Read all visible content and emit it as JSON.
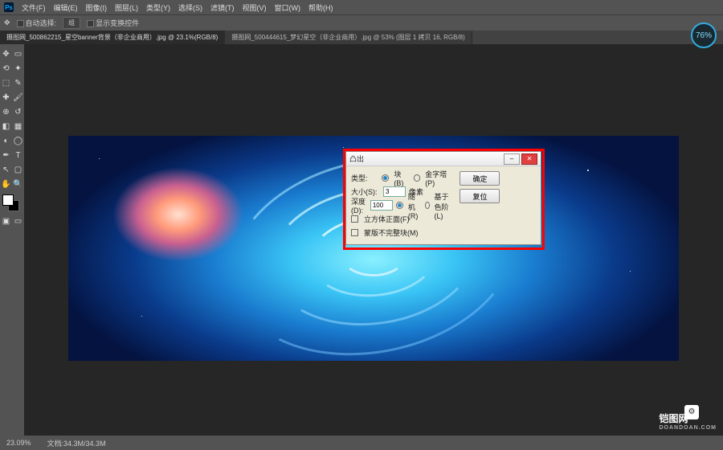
{
  "menubar": [
    "文件(F)",
    "编辑(E)",
    "图像(I)",
    "图层(L)",
    "类型(Y)",
    "选择(S)",
    "滤镜(T)",
    "视图(V)",
    "窗口(W)",
    "帮助(H)"
  ],
  "optbar": {
    "auto": "自动选择:",
    "sel": "组",
    "trans": "显示变换控件"
  },
  "tabs": [
    "摄图网_500862215_星空banner背景（非企业商用）.jpg @ 23.1%(RGB/8)",
    "摄图网_500444615_梦幻星空（非企业商用）.jpg @ 53% (图层 1 拷贝 16, RGB/8)"
  ],
  "pct_badge": "76%",
  "dialog": {
    "title": "凸出",
    "type_lbl": "类型:",
    "type_block": "块(B)",
    "type_pyramid": "金字塔(P)",
    "size_lbl": "大小(S):",
    "size_val": "3",
    "size_unit": "像素",
    "depth_lbl": "深度(D):",
    "depth_val": "100",
    "depth_rand": "随机(R)",
    "depth_level": "基于色阶(L)",
    "chk1": "立方体正面(F)",
    "chk2": "蒙版不完整块(M)",
    "ok": "确定",
    "cancel": "复位"
  },
  "status": {
    "zoom": "23.09%",
    "doc": "文档:34.3M/34.3M"
  },
  "brand": {
    "name": "铠图网",
    "url": "DOANDOAN.COM"
  }
}
